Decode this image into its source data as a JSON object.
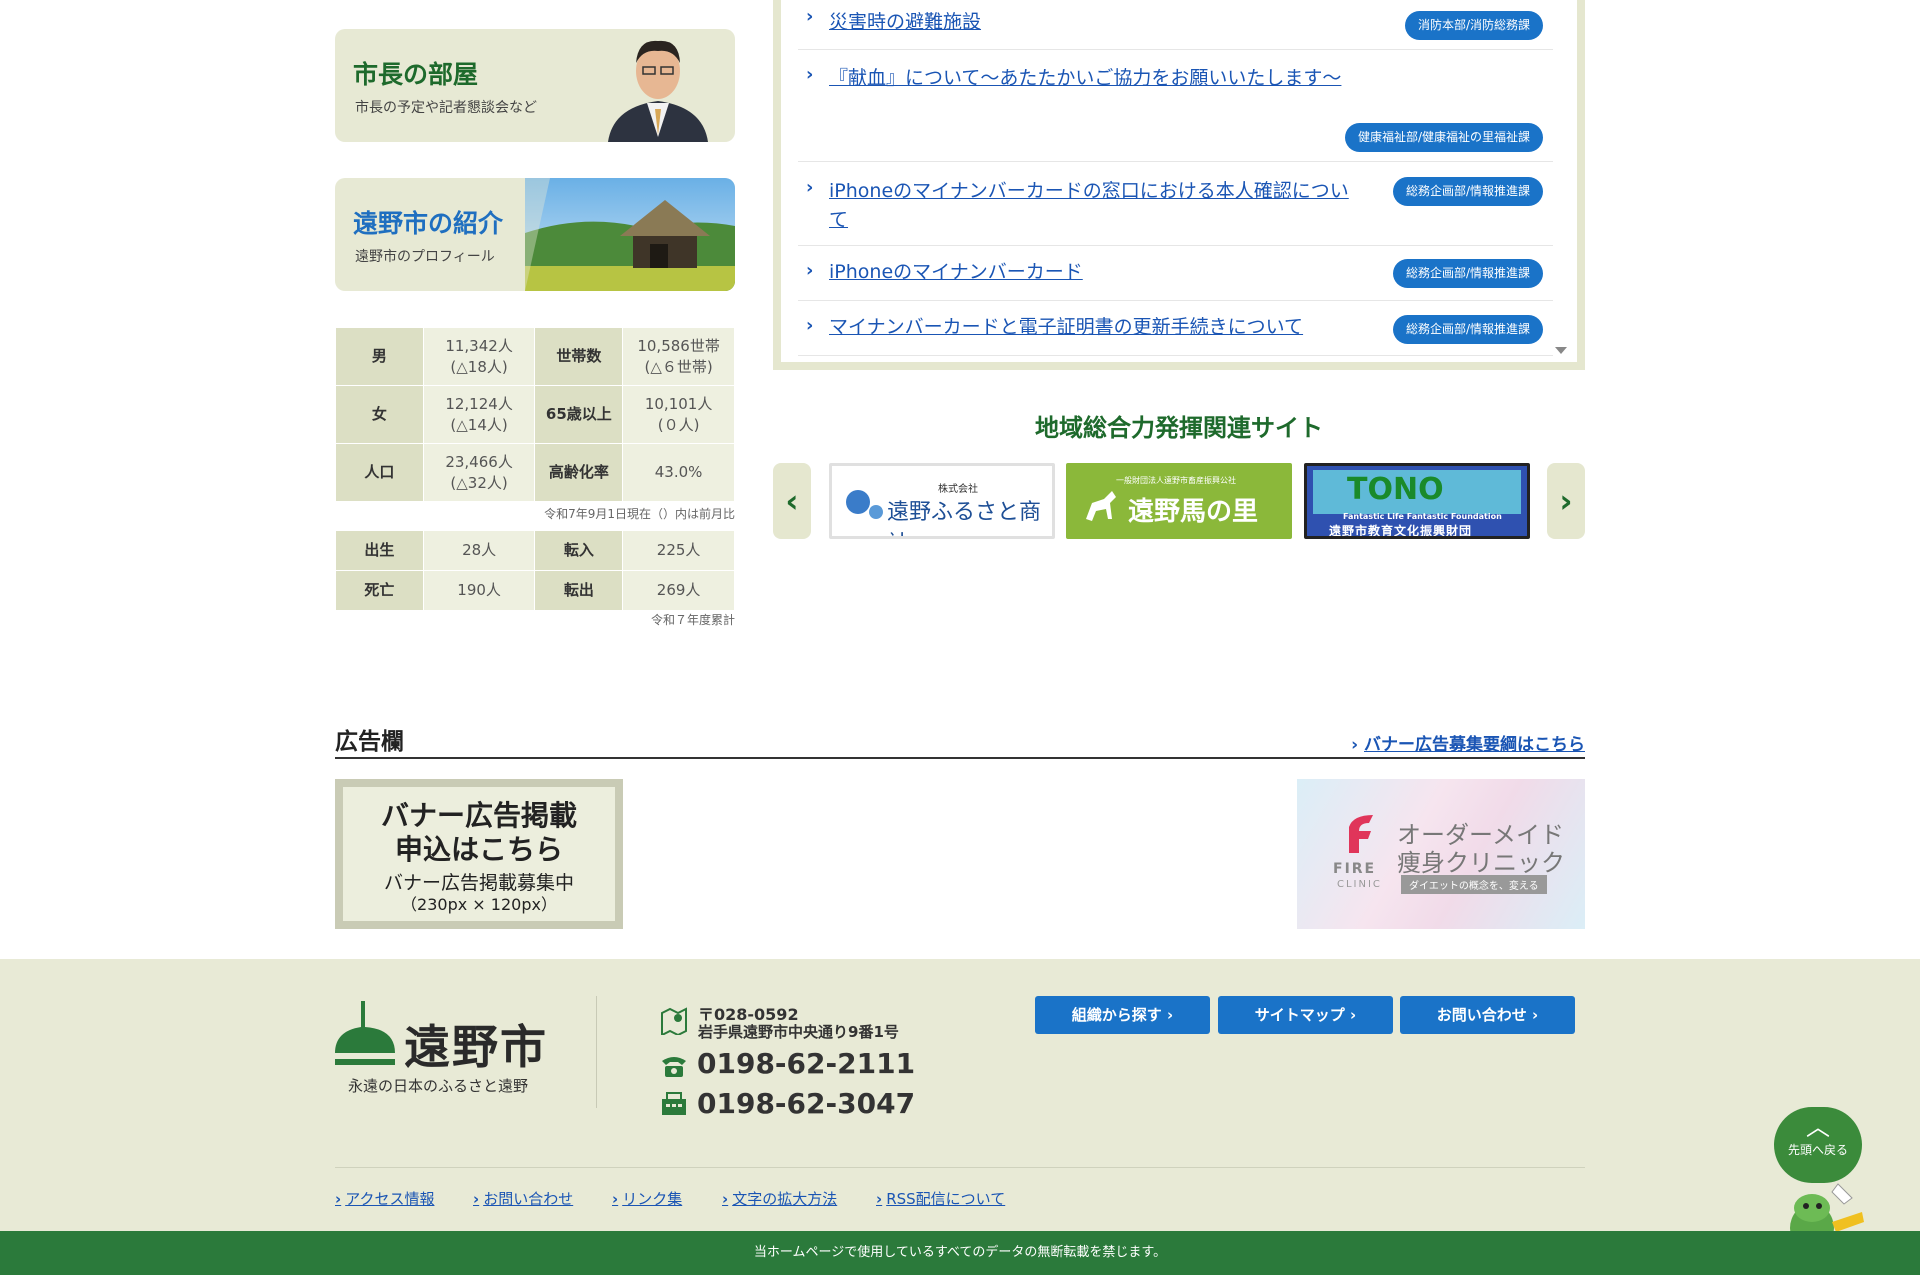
{
  "promos": {
    "mayor": {
      "title": "市長の部屋",
      "sub": "市長の予定や記者懇談会など"
    },
    "intro": {
      "title": "遠野市の紹介",
      "sub": "遠野市のプロフィール"
    }
  },
  "population": {
    "rows": [
      {
        "h1": "男",
        "v1a": "11,342人",
        "v1b": "(△18人)",
        "h2": "世帯数",
        "v2a": "10,586世帯",
        "v2b": "(△６世帯)"
      },
      {
        "h1": "女",
        "v1a": "12,124人",
        "v1b": "(△14人)",
        "h2": "65歳以上",
        "v2a": "10,101人",
        "v2b": "(０人)"
      },
      {
        "h1": "人口",
        "v1a": "23,466人",
        "v1b": "(△32人)",
        "h2": "高齢化率",
        "v2a": "43.0%",
        "v2b": ""
      }
    ],
    "note": "令和7年9月1日現在（）内は前月比"
  },
  "movement": {
    "rows": [
      {
        "h1": "出生",
        "v1": "28人",
        "h2": "転入",
        "v2": "225人"
      },
      {
        "h1": "死亡",
        "v1": "190人",
        "h2": "転出",
        "v2": "269人"
      }
    ],
    "note": "令和７年度累計"
  },
  "news": [
    {
      "title": "災害時の避難施設",
      "dept": "消防本部/消防総務課"
    },
    {
      "title": "『献血』について～あたたかいご協力をお願いいたします～",
      "dept": "健康福祉部/健康福祉の里福祉課"
    },
    {
      "title": "iPhoneのマイナンバーカードの窓口における本人確認について",
      "dept": "総務企画部/情報推進課"
    },
    {
      "title": "iPhoneのマイナンバーカード",
      "dept": "総務企画部/情報推進課"
    },
    {
      "title": "マイナンバーカードと電子証明書の更新手続きについて",
      "dept": "総務企画部/情報推進課"
    }
  ],
  "related": {
    "title": "地域総合力発揮関連サイト",
    "sites": [
      {
        "small": "株式会社",
        "name": "遠野ふるさと商社"
      },
      {
        "small": "一般財団法人遠野市畜産振興公社",
        "name": "遠野馬の里"
      },
      {
        "logo": "TONO",
        "small": "Fantastic Life Fantastic Foundation",
        "name": "遠野市教育文化振興財団"
      }
    ],
    "prev": "‹",
    "next": "›"
  },
  "ads": {
    "heading": "広告欄",
    "link": "バナー広告募集要綱はこちら",
    "banner1": {
      "line1": "バナー広告掲載",
      "line2": "申込はこちら",
      "line3": "バナー広告掲載募集中",
      "line4": "（230px × 120px）"
    },
    "banner2": {
      "line1": "オーダーメイド",
      "line2": "痩身クリニック",
      "badge": "ダイエットの概念を、変える",
      "brand": "FIRE",
      "brand_sub": "CLINIC"
    }
  },
  "footer": {
    "logo": "遠野市",
    "tagline": "永遠の日本のふるさと遠野",
    "postal": "〒028-0592",
    "address": "岩手県遠野市中央通り9番1号",
    "tel": "0198-62-2111",
    "fax": "0198-62-3047",
    "buttons": [
      "組織から探す",
      "サイトマップ",
      "お問い合わせ"
    ],
    "links": [
      "アクセス情報",
      "お問い合わせ",
      "リンク集",
      "文字の拡大方法",
      "RSS配信について"
    ],
    "to_top": "先頭へ戻る",
    "copyright": "当ホームページで使用しているすべてのデータの無断転載を禁じます。"
  },
  "colors": {
    "green": "#1e6a2c",
    "blue": "#1a73c8",
    "footer_bg": "#e8ead6",
    "copy_bg": "#2b7a3b"
  }
}
